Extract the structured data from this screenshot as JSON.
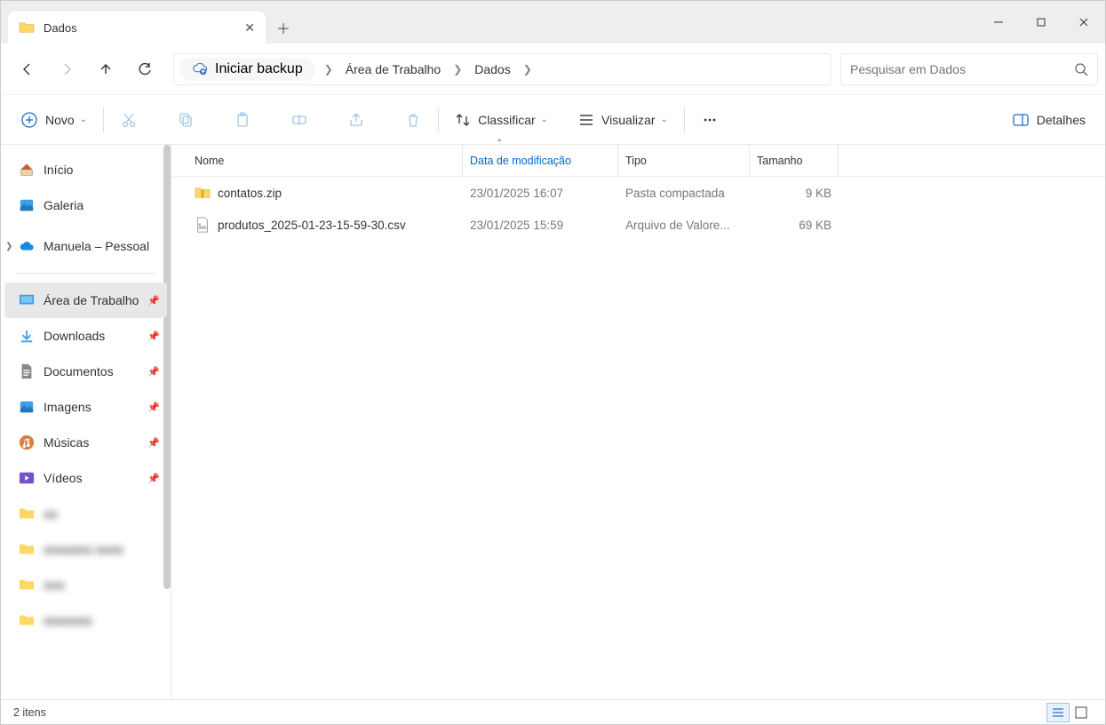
{
  "tab": {
    "title": "Dados"
  },
  "breadcrumb": {
    "backup_label": "Iniciar backup",
    "segments": [
      "Área de Trabalho",
      "Dados"
    ]
  },
  "search": {
    "placeholder": "Pesquisar em Dados"
  },
  "toolbar": {
    "new_label": "Novo",
    "sort_label": "Classificar",
    "view_label": "Visualizar",
    "details_label": "Detalhes"
  },
  "sidebar": {
    "home": "Início",
    "gallery": "Galeria",
    "onedrive": "Manuela – Pessoal",
    "desktop": "Área de Trabalho",
    "downloads": "Downloads",
    "documents": "Documentos",
    "pictures": "Imagens",
    "music": "Músicas",
    "videos": "Vídeos",
    "redacted1": "aa",
    "redacted2": "aaaaaaa aaaa",
    "redacted3": "aaa",
    "redacted4": "aaaaaaa"
  },
  "columns": {
    "name": "Nome",
    "date": "Data de modificação",
    "type": "Tipo",
    "size": "Tamanho"
  },
  "files": [
    {
      "name": "contatos.zip",
      "date": "23/01/2025 16:07",
      "type": "Pasta compactada",
      "size": "9 KB",
      "icon": "zip"
    },
    {
      "name": "produtos_2025-01-23-15-59-30.csv",
      "date": "23/01/2025 15:59",
      "type": "Arquivo de Valore...",
      "size": "69 KB",
      "icon": "csv"
    }
  ],
  "status": {
    "count_label": "2 itens"
  }
}
